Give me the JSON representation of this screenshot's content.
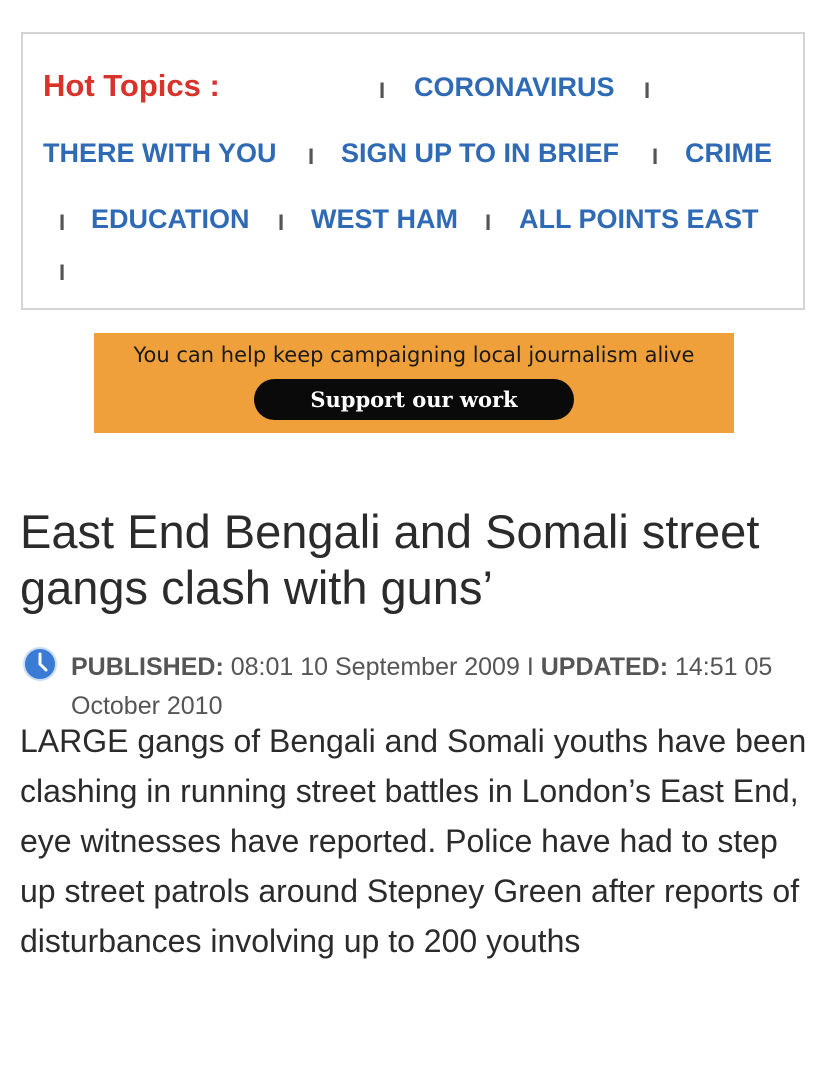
{
  "hot_topics": {
    "title": "Hot Topics :",
    "separator": "I",
    "links": [
      {
        "label": "CORONAVIRUS"
      },
      {
        "label": "THERE WITH YOU"
      },
      {
        "label": "SIGN UP TO IN BRIEF"
      },
      {
        "label": "CRIME"
      },
      {
        "label": "EDUCATION"
      },
      {
        "label": "WEST HAM"
      },
      {
        "label": "ALL POINTS EAST"
      }
    ]
  },
  "support_banner": {
    "text": "You can help keep campaigning local journalism alive",
    "button_label": "Support our work"
  },
  "article": {
    "headline": "East End Bengali and Somali street gangs clash with guns’",
    "published_label": "PUBLISHED:",
    "published_value": "08:01 10 September 2009",
    "meta_separator": "I",
    "updated_label": "UPDATED:",
    "updated_value": "14:51 05 October 2010",
    "body": "LARGE gangs of Bengali and Somali youths have been clashing in running street battles in London’s East End, eye witnesses have reported. Police have had to step up street patrols around Stepney Green after reports of disturbances involving up to 200 youths"
  },
  "colors": {
    "hot_topics_title": "#d8322a",
    "topic_link": "#2e6ab5",
    "banner_bg": "#f0a03a",
    "button_bg": "#0a0a0a",
    "clock_icon": "#3a7bd5"
  }
}
